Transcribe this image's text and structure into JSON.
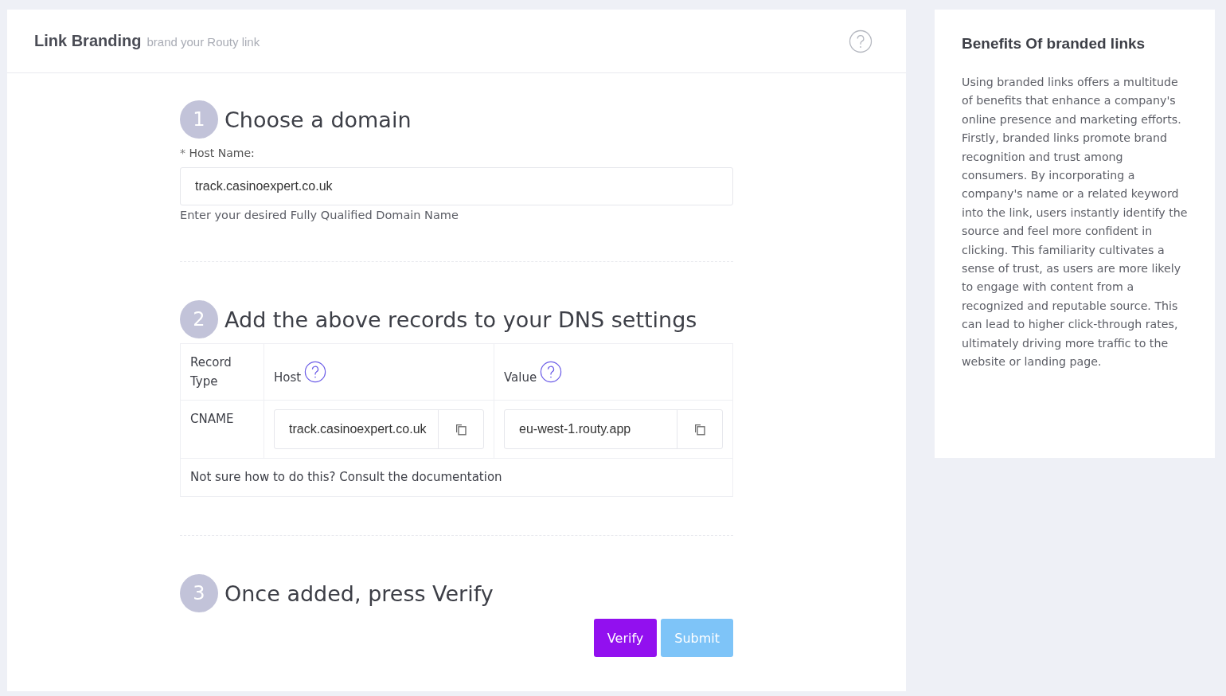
{
  "header": {
    "title": "Link Branding",
    "subtitle": "brand your Routy link"
  },
  "steps": [
    {
      "number": "1",
      "title": "Choose a domain"
    },
    {
      "number": "2",
      "title": "Add the above records to your DNS settings"
    },
    {
      "number": "3",
      "title": "Once added, press Verify"
    }
  ],
  "host_field": {
    "label": "Host Name:",
    "required_mark": "*",
    "value": "track.casinoexpert.co.uk",
    "hint": "Enter your desired Fully Qualified Domain Name"
  },
  "dns_table": {
    "columns": [
      "Record Type",
      "Host",
      "Value"
    ],
    "rows": [
      {
        "type": "CNAME",
        "host": "track.casinoexpert.co.uk",
        "value": "eu-west-1.routy.app"
      }
    ],
    "footer": "Not sure how to do this? Consult the documentation"
  },
  "buttons": [
    {
      "label": "Verify",
      "disabled": false
    },
    {
      "label": "Submit",
      "disabled": true
    }
  ],
  "sidebar": {
    "title": "Benefits Of branded links",
    "text": "Using branded links offers a multitude of benefits that enhance a company's online presence and marketing efforts. Firstly, branded links promote brand recognition and trust among consumers. By incorporating a company's name or a related keyword into the link, users instantly identify the source and feel more confident in clicking. This familiarity cultivates a sense of trust, as users are more likely to engage with content from a recognized and reputable source. This can lead to higher click-through rates, ultimately driving more traffic to the website or landing page."
  }
}
